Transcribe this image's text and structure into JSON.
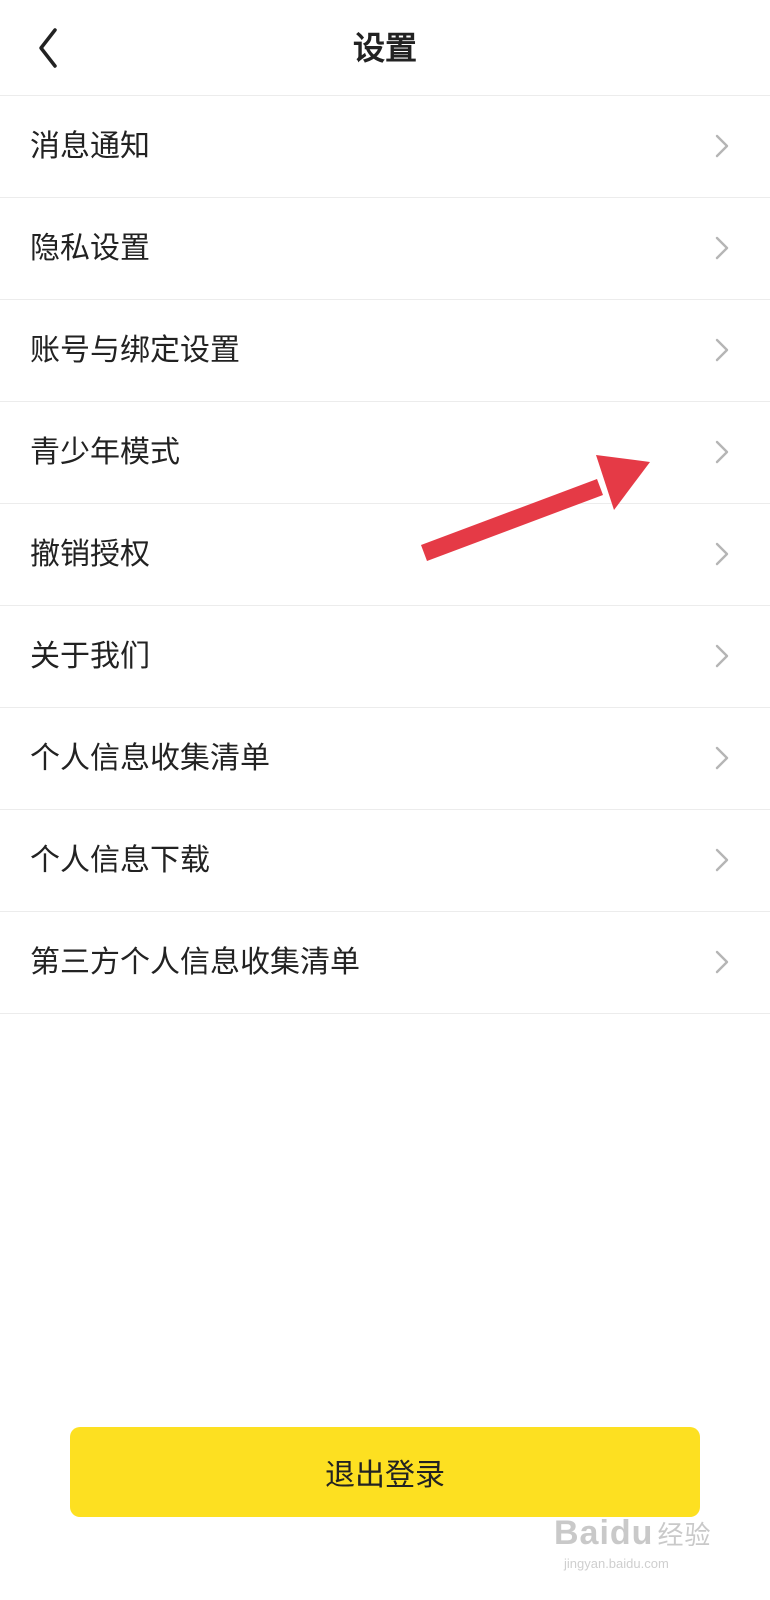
{
  "header": {
    "title": "设置",
    "back_icon": "chevron-left-icon"
  },
  "menu": {
    "items": [
      {
        "label": "消息通知",
        "icon": "chevron-right-icon"
      },
      {
        "label": "隐私设置",
        "icon": "chevron-right-icon"
      },
      {
        "label": "账号与绑定设置",
        "icon": "chevron-right-icon"
      },
      {
        "label": "青少年模式",
        "icon": "chevron-right-icon"
      },
      {
        "label": "撤销授权",
        "icon": "chevron-right-icon"
      },
      {
        "label": "关于我们",
        "icon": "chevron-right-icon"
      },
      {
        "label": "个人信息收集清单",
        "icon": "chevron-right-icon"
      },
      {
        "label": "个人信息下载",
        "icon": "chevron-right-icon"
      },
      {
        "label": "第三方个人信息收集清单",
        "icon": "chevron-right-icon"
      }
    ]
  },
  "footer": {
    "logout_label": "退出登录"
  },
  "watermark": {
    "brand": "Baidu",
    "brand_cn": "经验",
    "url": "jingyan.baidu.com"
  },
  "colors": {
    "accent_yellow": "#fde021",
    "annotation_red": "#e53a46",
    "text": "#222222",
    "divider": "#ececec",
    "chevron": "#b5b5b5"
  }
}
